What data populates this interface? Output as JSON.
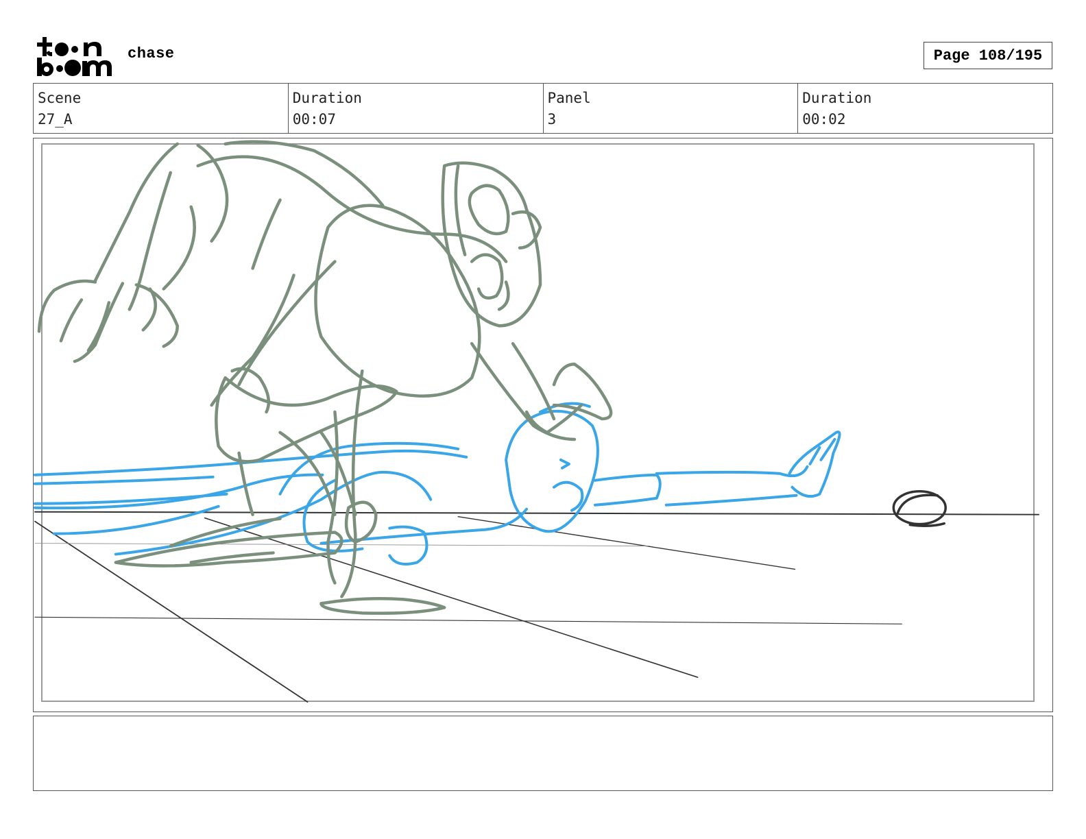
{
  "header": {
    "logo_text": "toon boom",
    "project_title": "chase",
    "page_label": "Page 108/195"
  },
  "info": {
    "scene_label": "Scene",
    "scene_value": "27_A",
    "scene_duration_label": "Duration",
    "scene_duration_value": "00:07",
    "panel_label": "Panel",
    "panel_value": "3",
    "panel_duration_label": "Duration",
    "panel_duration_value": "00:02"
  },
  "panel": {
    "colors": {
      "character_one": "#7a8f7c",
      "character_two": "#3aa6e8",
      "ground_lines": "#333333",
      "safe_frame": "#9a9a9a"
    }
  },
  "notes": {
    "text": ""
  }
}
